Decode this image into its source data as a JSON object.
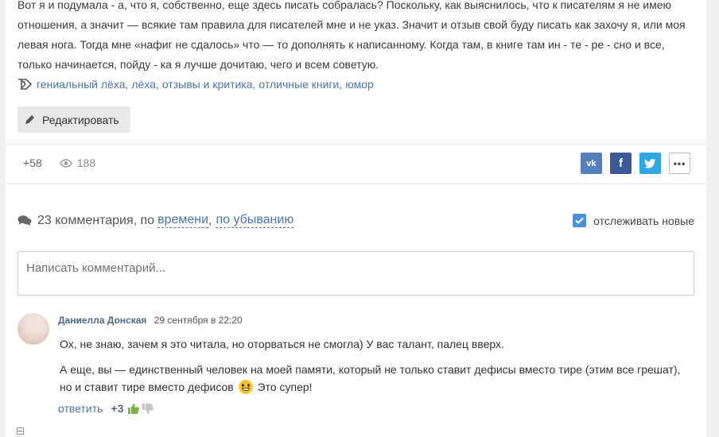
{
  "post": {
    "paragraph": "Вот я и подумала - а, что я, собственно, еще здесь писать собралась? Поскольку, как выяснилось, что к писателям я не имею отношения, а значит — всякие там правила для писателей мне и не указ. Значит и отзыв свой буду писать как захочу я, или моя левая нога. Тогда мне «нафиг не сдалось» что — то дополнять к написанному. Когда там, в книге там ин - те - ре - сно и  все, только начинается, пойду -  ка я лучше дочитаю, чего и всем советую.",
    "tags": [
      "гениальный лёха",
      "лёха",
      "отзывы и критика",
      "отличные книги",
      "юмор"
    ],
    "edit_label": "Редактировать"
  },
  "stats": {
    "rating": "+58",
    "views": "188"
  },
  "share": {
    "vk": "vk",
    "fb": "f",
    "more": "•••"
  },
  "comments": {
    "count_label": "23 комментария, по",
    "sort_time": "времени",
    "sort_sep": ",",
    "sort_order": "по убыванию",
    "follow_label": "отслеживать новые",
    "input_placeholder": "Написать комментарий...",
    "items": [
      {
        "author": "Даниелла Донская",
        "date": "29 сентября в 22:20",
        "p1": "Ох, не знаю, зачем я это читала, но оторваться не смогла) У вас талант, палец вверх.",
        "p2_before": "А еще, вы — единственный человек на моей памяти, который не только ставит дефисы вместо тире (этим все грешат), но и ставит тире вместо дефисов",
        "p2_after": " Это супер!",
        "reply_label": "ответить",
        "rating": "+3"
      }
    ]
  },
  "colors": {
    "accent": "#4a76a8",
    "vk": "#5181b8",
    "facebook": "#3b5998",
    "twitter": "#2fa7e4",
    "checkbox": "#4a90d9"
  }
}
